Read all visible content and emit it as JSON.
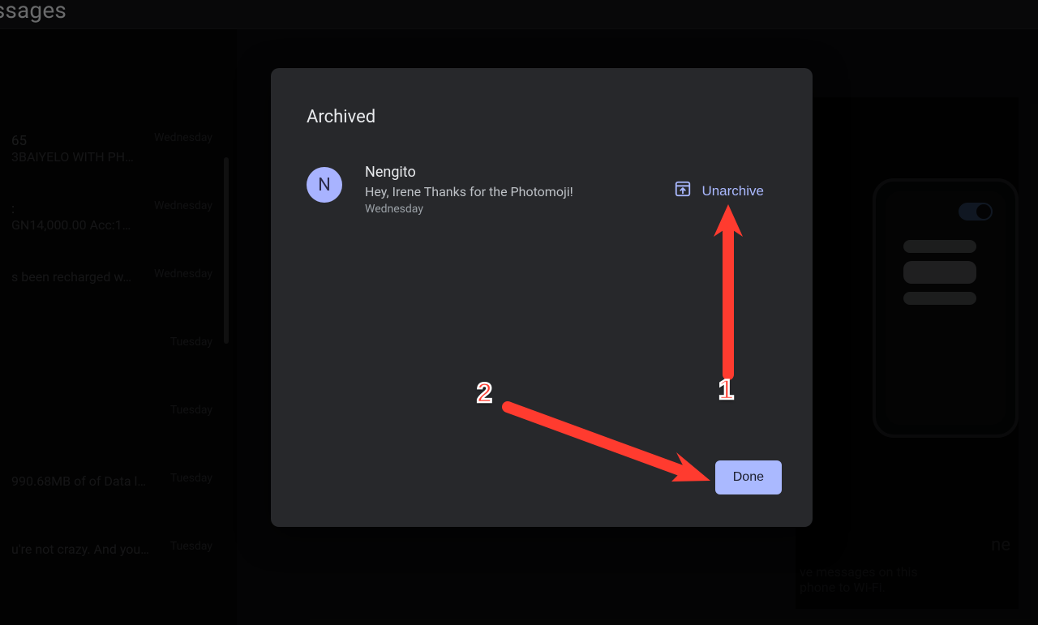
{
  "page_title": "Messages",
  "sidebar": {
    "items": [
      {
        "line1": "65",
        "line2": "3BAIYELO WITH PH…",
        "day": "Wednesday"
      },
      {
        "line1": ":",
        "line2": "GN14,000.00 Acc:1…",
        "day": "Wednesday"
      },
      {
        "line1": "",
        "line2": "s been recharged w…",
        "day": "Wednesday"
      },
      {
        "line1": "",
        "line2": "",
        "day": "Tuesday"
      },
      {
        "line1": "",
        "line2": "",
        "day": "Tuesday"
      },
      {
        "line1": "",
        "line2": "990.68MB of of Data l…",
        "day": "Tuesday"
      },
      {
        "line1": "",
        "line2": "u're not crazy. And you…",
        "day": "Tuesday"
      }
    ]
  },
  "right_promo": {
    "heading_tail": "ne",
    "line1_tail": "ve messages on this",
    "line2_tail": "phone to Wi-Fi."
  },
  "modal": {
    "title": "Archived",
    "avatar_initial": "N",
    "item_name": "Nengito",
    "item_preview": "Hey, Irene Thanks for the Photomoji!",
    "item_day": "Wednesday",
    "unarchive_label": "Unarchive",
    "done_label": "Done"
  },
  "annotations": {
    "step1": "1",
    "step2": "2"
  },
  "colors": {
    "accent": "#aab9ff",
    "annotation": "#ff3b2f",
    "modal_bg": "#27282b"
  }
}
